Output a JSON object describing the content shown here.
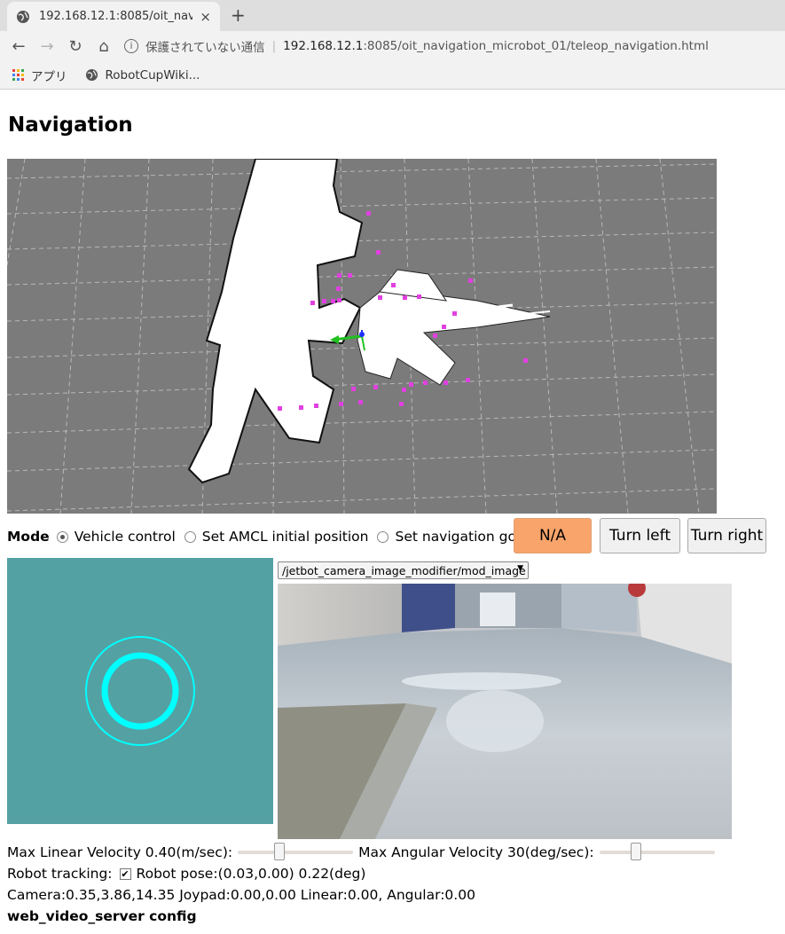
{
  "browser": {
    "tab_title": "192.168.12.1:8085/oit_nav",
    "tab_close": "×",
    "new_tab": "+",
    "security_text": "保護されていない通信",
    "url_host": "192.168.12.1",
    "url_rest": ":8085/oit_navigation_microbot_01/teleop_navigation.html",
    "bookmarks": [
      {
        "label": "アプリ",
        "icon": "apps-grid-icon"
      },
      {
        "label": "RobotCupWiki...",
        "icon": "globe-icon"
      }
    ]
  },
  "page": {
    "title": "Navigation",
    "mode": {
      "label": "Mode",
      "options": [
        {
          "label": "Vehicle control",
          "selected": true
        },
        {
          "label": "Set AMCL initial position",
          "selected": false
        },
        {
          "label": "Set navigation goal",
          "selected": false
        }
      ]
    },
    "buttons": {
      "status": "N/A",
      "turn_left": "Turn left",
      "turn_right": "Turn right"
    },
    "camera_topic": "/jetbot_camera_image_modifier/mod_image",
    "max_linear": "Max Linear Velocity 0.40(m/sec):",
    "max_linear_fraction": 0.35,
    "max_angular": "Max Angular Velocity 30(deg/sec):",
    "max_angular_fraction": 0.3,
    "robot_tracking": "Robot tracking:",
    "robot_tracking_checked": true,
    "robot_pose": "Robot pose:(0.03,0.00) 0.22(deg)",
    "status_line": "Camera:0.35,3.86,14.35 Joypad:0.00,0.00 Linear:0.00, Angular:0.00",
    "config_heading": "web_video_server config"
  },
  "colors": {
    "status_button": "#f9a46b",
    "joypad_bg": "#54a1a3",
    "joypad_ring": "#00ffff",
    "map_bg": "#7b7b7b",
    "particles": "#e040e0"
  }
}
